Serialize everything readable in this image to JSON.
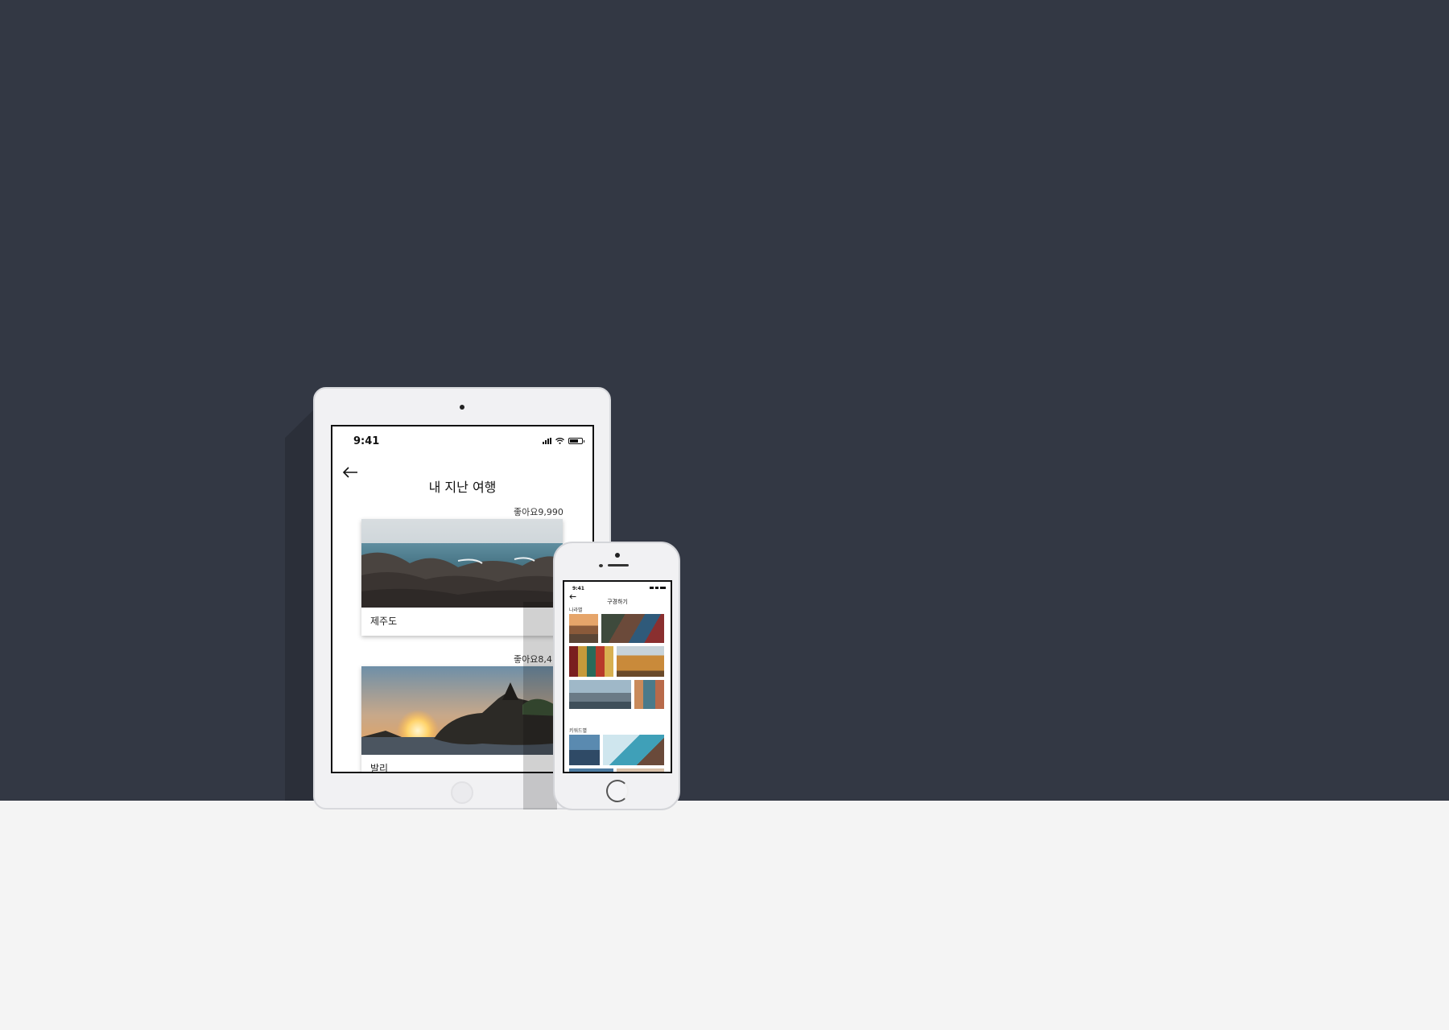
{
  "tablet": {
    "status_time": "9:41",
    "page_title": "내 지난 여행",
    "trips": [
      {
        "likes": "좋아요9,990",
        "name": "제주도"
      },
      {
        "likes": "좋아요8,4",
        "name": "발리"
      }
    ]
  },
  "phone": {
    "status_time": "9:41",
    "page_title": "구경하기",
    "sections": [
      {
        "label": "나라별"
      },
      {
        "label": "키워드별"
      }
    ]
  },
  "colors": {
    "backdrop": "#333844",
    "floor": "#f4f4f4",
    "device_body": "#f1f1f3"
  },
  "icons": [
    "back-arrow-icon",
    "signal-icon",
    "wifi-icon",
    "battery-icon",
    "home-button-icon"
  ]
}
